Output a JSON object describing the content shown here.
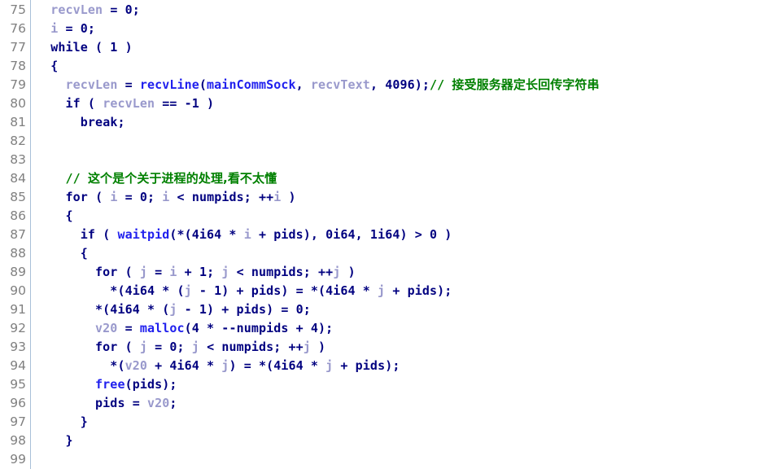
{
  "editor": {
    "kind": "decompiler-pseudocode-view",
    "first_line_number": 75,
    "last_line_number": 99,
    "colors": {
      "background": "#ffffff",
      "gutter_text": "#808080",
      "gutter_divider": "#a8c0d8",
      "default_text": "#000080",
      "keyword": "#000080",
      "number": "#000080",
      "local_variable": "#9999cc",
      "function_name": "#2020ee",
      "global_symbol": "#2020ee",
      "comment": "#008000"
    }
  },
  "lines": [
    {
      "number": "75",
      "tokens": [
        {
          "text": "  ",
          "cls": "t-def"
        },
        {
          "text": "recvLen",
          "cls": "t-var"
        },
        {
          "text": " = 0;",
          "cls": "t-def"
        }
      ]
    },
    {
      "number": "76",
      "tokens": [
        {
          "text": "  ",
          "cls": "t-def"
        },
        {
          "text": "i",
          "cls": "t-var"
        },
        {
          "text": " = 0;",
          "cls": "t-def"
        }
      ]
    },
    {
      "number": "77",
      "tokens": [
        {
          "text": "  ",
          "cls": "t-def"
        },
        {
          "text": "while ( 1 )",
          "cls": "t-kw"
        }
      ]
    },
    {
      "number": "78",
      "tokens": [
        {
          "text": "  {",
          "cls": "t-def"
        }
      ]
    },
    {
      "number": "79",
      "tokens": [
        {
          "text": "    ",
          "cls": "t-def"
        },
        {
          "text": "recvLen",
          "cls": "t-var"
        },
        {
          "text": " = ",
          "cls": "t-def"
        },
        {
          "text": "recvLine",
          "cls": "t-fn"
        },
        {
          "text": "(",
          "cls": "t-def"
        },
        {
          "text": "mainCommSock",
          "cls": "t-glob"
        },
        {
          "text": ", ",
          "cls": "t-def"
        },
        {
          "text": "recvText",
          "cls": "t-var"
        },
        {
          "text": ", 4096);",
          "cls": "t-def"
        },
        {
          "text": "// ",
          "cls": "t-cmt"
        },
        {
          "text": "接受服务器定长回传字符串",
          "cls": "t-cmt-cjk"
        }
      ]
    },
    {
      "number": "80",
      "tokens": [
        {
          "text": "    ",
          "cls": "t-def"
        },
        {
          "text": "if",
          "cls": "t-kw"
        },
        {
          "text": " ( ",
          "cls": "t-def"
        },
        {
          "text": "recvLen",
          "cls": "t-var"
        },
        {
          "text": " == -1 )",
          "cls": "t-def"
        }
      ]
    },
    {
      "number": "81",
      "tokens": [
        {
          "text": "      ",
          "cls": "t-def"
        },
        {
          "text": "break;",
          "cls": "t-kw"
        }
      ]
    },
    {
      "number": "82",
      "tokens": []
    },
    {
      "number": "83",
      "tokens": []
    },
    {
      "number": "84",
      "tokens": [
        {
          "text": "    ",
          "cls": "t-def"
        },
        {
          "text": "// ",
          "cls": "t-cmt"
        },
        {
          "text": "这个是个关于进程的处理,看不太懂",
          "cls": "t-cmt-cjk"
        }
      ]
    },
    {
      "number": "85",
      "tokens": [
        {
          "text": "    ",
          "cls": "t-def"
        },
        {
          "text": "for",
          "cls": "t-kw"
        },
        {
          "text": " ( ",
          "cls": "t-def"
        },
        {
          "text": "i",
          "cls": "t-var"
        },
        {
          "text": " = 0; ",
          "cls": "t-def"
        },
        {
          "text": "i",
          "cls": "t-var"
        },
        {
          "text": " < numpids; ++",
          "cls": "t-def"
        },
        {
          "text": "i",
          "cls": "t-var"
        },
        {
          "text": " )",
          "cls": "t-def"
        }
      ]
    },
    {
      "number": "86",
      "tokens": [
        {
          "text": "    {",
          "cls": "t-def"
        }
      ]
    },
    {
      "number": "87",
      "tokens": [
        {
          "text": "      ",
          "cls": "t-def"
        },
        {
          "text": "if",
          "cls": "t-kw"
        },
        {
          "text": " ( ",
          "cls": "t-def"
        },
        {
          "text": "waitpid",
          "cls": "t-fn"
        },
        {
          "text": "(*(4i64 * ",
          "cls": "t-def"
        },
        {
          "text": "i",
          "cls": "t-var"
        },
        {
          "text": " + pids), 0i64, 1i64) > 0 )",
          "cls": "t-def"
        }
      ]
    },
    {
      "number": "88",
      "tokens": [
        {
          "text": "      {",
          "cls": "t-def"
        }
      ]
    },
    {
      "number": "89",
      "tokens": [
        {
          "text": "        ",
          "cls": "t-def"
        },
        {
          "text": "for",
          "cls": "t-kw"
        },
        {
          "text": " ( ",
          "cls": "t-def"
        },
        {
          "text": "j",
          "cls": "t-var"
        },
        {
          "text": " = ",
          "cls": "t-def"
        },
        {
          "text": "i",
          "cls": "t-var"
        },
        {
          "text": " + 1; ",
          "cls": "t-def"
        },
        {
          "text": "j",
          "cls": "t-var"
        },
        {
          "text": " < numpids; ++",
          "cls": "t-def"
        },
        {
          "text": "j",
          "cls": "t-var"
        },
        {
          "text": " )",
          "cls": "t-def"
        }
      ]
    },
    {
      "number": "90",
      "tokens": [
        {
          "text": "          *(4i64 * (",
          "cls": "t-def"
        },
        {
          "text": "j",
          "cls": "t-var"
        },
        {
          "text": " - 1) + pids) = *(4i64 * ",
          "cls": "t-def"
        },
        {
          "text": "j",
          "cls": "t-var"
        },
        {
          "text": " + pids);",
          "cls": "t-def"
        }
      ]
    },
    {
      "number": "91",
      "tokens": [
        {
          "text": "        *(4i64 * (",
          "cls": "t-def"
        },
        {
          "text": "j",
          "cls": "t-var"
        },
        {
          "text": " - 1) + pids) = 0;",
          "cls": "t-def"
        }
      ]
    },
    {
      "number": "92",
      "tokens": [
        {
          "text": "        ",
          "cls": "t-def"
        },
        {
          "text": "v20",
          "cls": "t-var"
        },
        {
          "text": " = ",
          "cls": "t-def"
        },
        {
          "text": "malloc",
          "cls": "t-fn"
        },
        {
          "text": "(4 * --numpids + 4);",
          "cls": "t-def"
        }
      ]
    },
    {
      "number": "93",
      "tokens": [
        {
          "text": "        ",
          "cls": "t-def"
        },
        {
          "text": "for",
          "cls": "t-kw"
        },
        {
          "text": " ( ",
          "cls": "t-def"
        },
        {
          "text": "j",
          "cls": "t-var"
        },
        {
          "text": " = 0; ",
          "cls": "t-def"
        },
        {
          "text": "j",
          "cls": "t-var"
        },
        {
          "text": " < numpids; ++",
          "cls": "t-def"
        },
        {
          "text": "j",
          "cls": "t-var"
        },
        {
          "text": " )",
          "cls": "t-def"
        }
      ]
    },
    {
      "number": "94",
      "tokens": [
        {
          "text": "          *(",
          "cls": "t-def"
        },
        {
          "text": "v20",
          "cls": "t-var"
        },
        {
          "text": " + 4i64 * ",
          "cls": "t-def"
        },
        {
          "text": "j",
          "cls": "t-var"
        },
        {
          "text": ") = *(4i64 * ",
          "cls": "t-def"
        },
        {
          "text": "j",
          "cls": "t-var"
        },
        {
          "text": " + pids);",
          "cls": "t-def"
        }
      ]
    },
    {
      "number": "95",
      "tokens": [
        {
          "text": "        ",
          "cls": "t-def"
        },
        {
          "text": "free",
          "cls": "t-fn"
        },
        {
          "text": "(pids);",
          "cls": "t-def"
        }
      ]
    },
    {
      "number": "96",
      "tokens": [
        {
          "text": "        pids = ",
          "cls": "t-def"
        },
        {
          "text": "v20",
          "cls": "t-var"
        },
        {
          "text": ";",
          "cls": "t-def"
        }
      ]
    },
    {
      "number": "97",
      "tokens": [
        {
          "text": "      }",
          "cls": "t-def"
        }
      ]
    },
    {
      "number": "98",
      "tokens": [
        {
          "text": "    }",
          "cls": "t-def"
        }
      ]
    },
    {
      "number": "99",
      "tokens": []
    }
  ]
}
